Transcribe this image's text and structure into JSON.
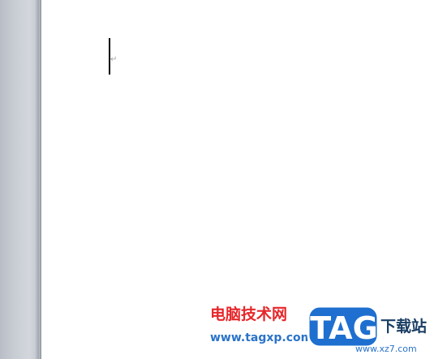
{
  "document": {
    "paragraph_mark": "↵"
  },
  "watermark": {
    "site_name": "电脑技术网",
    "site_url": "www.tagxp.com",
    "logo_text": "TAG",
    "right_name": "下载站",
    "right_url": "www.xz7.com",
    "colors": {
      "site_name": "#e6262a",
      "site_url": "#2a73c8",
      "logo_fill": "#1e6fcf",
      "logo_text": "#ffffff"
    }
  }
}
